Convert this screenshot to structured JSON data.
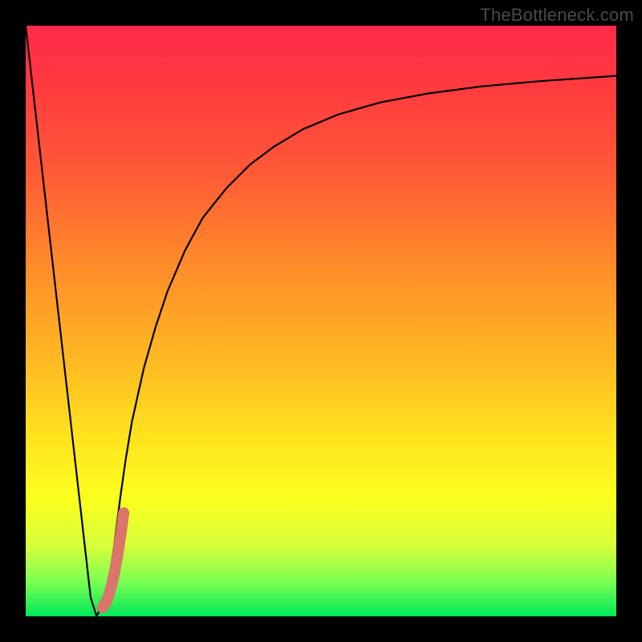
{
  "watermark": {
    "text": "TheBottleneck.com"
  },
  "chart_data": {
    "type": "line",
    "title": "",
    "xlabel": "",
    "ylabel": "",
    "xlim": [
      0,
      100
    ],
    "ylim": [
      0,
      100
    ],
    "series": [
      {
        "name": "black-curve",
        "x": [
          0,
          1,
          2,
          3,
          4,
          5,
          6,
          7,
          8,
          9,
          10,
          11,
          12,
          13,
          14,
          15,
          16,
          17,
          18,
          20,
          22,
          24,
          27,
          30,
          34,
          38,
          42,
          47,
          53,
          60,
          68,
          77,
          87,
          100
        ],
        "values": [
          100,
          91.2,
          82.4,
          73.6,
          64.8,
          56,
          47.2,
          38.4,
          29.6,
          20.8,
          12,
          3.2,
          0,
          2,
          5.5,
          12,
          20,
          27,
          33,
          42,
          49,
          55,
          62,
          67.5,
          72.5,
          76.5,
          79.5,
          82.5,
          85,
          87,
          88.5,
          89.7,
          90.6,
          91.5
        ]
      },
      {
        "name": "red-marker",
        "x": [
          13.0,
          13.4,
          13.8,
          14.2,
          14.6,
          15.0,
          15.4,
          15.8,
          16.2,
          16.6
        ],
        "values": [
          1.5,
          2.0,
          2.8,
          4.0,
          5.5,
          7.3,
          9.4,
          11.8,
          14.5,
          17.5
        ]
      }
    ],
    "background_gradient": {
      "orientation": "vertical",
      "stops": [
        {
          "pos": 0,
          "color": "#ff2a4a"
        },
        {
          "pos": 0.55,
          "color": "#ffb424"
        },
        {
          "pos": 0.8,
          "color": "#fbff1e"
        },
        {
          "pos": 1.0,
          "color": "#00e85a"
        }
      ]
    }
  }
}
